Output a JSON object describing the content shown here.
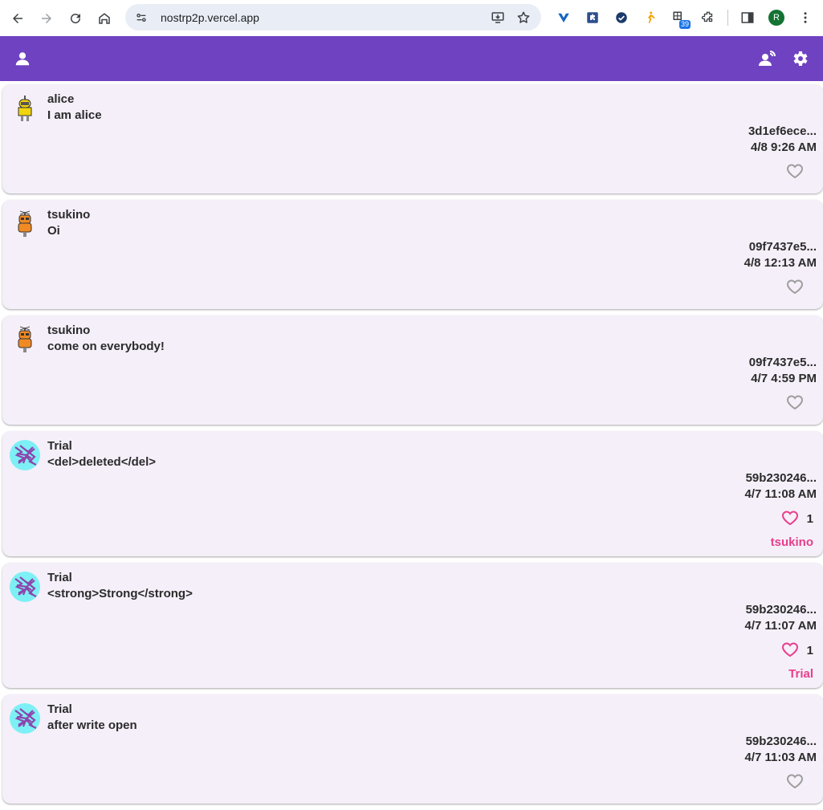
{
  "browser": {
    "url": "nostrp2p.vercel.app",
    "badge_count": "39",
    "profile_initial": "R"
  },
  "colors": {
    "appbar": "#6f42c1",
    "card_bg": "#f5eff9",
    "like_active": "#e83e8c",
    "like_inactive": "#9e9e9e"
  },
  "posts": [
    {
      "name": "alice",
      "content": "I am alice",
      "pubkey": "3d1ef6ece...",
      "time": "4/8 9:26 AM",
      "avatar": "robot-yellow-icon",
      "liked": false
    },
    {
      "name": "tsukino",
      "content": "Oi",
      "pubkey": "09f7437e5...",
      "time": "4/8 12:13 AM",
      "avatar": "robot-orange-icon",
      "liked": false
    },
    {
      "name": "tsukino",
      "content": "come on everybody!",
      "pubkey": "09f7437e5...",
      "time": "4/7 4:59 PM",
      "avatar": "robot-orange-icon",
      "liked": false
    },
    {
      "name": "Trial",
      "content": "<del>deleted</del>",
      "pubkey": "59b230246...",
      "time": "4/7 11:08 AM",
      "avatar": "pattern-cyan-icon",
      "liked": true,
      "like_count": "1",
      "liker": "tsukino"
    },
    {
      "name": "Trial",
      "content": "<strong>Strong</strong>",
      "pubkey": "59b230246...",
      "time": "4/7 11:07 AM",
      "avatar": "pattern-cyan-icon",
      "liked": true,
      "like_count": "1",
      "liker": "Trial"
    },
    {
      "name": "Trial",
      "content": "after write open",
      "pubkey": "59b230246...",
      "time": "4/7 11:03 AM",
      "avatar": "pattern-cyan-icon",
      "liked": false
    }
  ]
}
